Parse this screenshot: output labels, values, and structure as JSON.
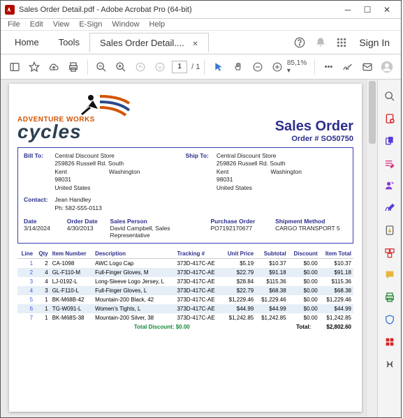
{
  "window": {
    "title": "Sales Order Detail.pdf - Adobe Acrobat Pro (64-bit)"
  },
  "menu": {
    "file": "File",
    "edit": "Edit",
    "view": "View",
    "esign": "E-Sign",
    "window": "Window",
    "help": "Help"
  },
  "tabs": {
    "home": "Home",
    "tools": "Tools",
    "active": "Sales Order Detail...."
  },
  "signin": "Sign In",
  "toolbar": {
    "page_cur": "1",
    "page_sep": "/",
    "page_total": "1",
    "zoom": "85,1%"
  },
  "doc": {
    "brand_top": "ADVENTURE WORKS",
    "brand_bottom": "cycles",
    "order_title": "Sales Order",
    "order_number_lbl": "Order # ",
    "order_number": "SO50750",
    "billto_lbl": "Bill To:",
    "shipto_lbl": "Ship To:",
    "bill": {
      "name": "Central Discount Store",
      "addr1": "259826 Russell Rd. South",
      "city": "Kent",
      "state": "Washington",
      "zip": "98031",
      "country": "United States"
    },
    "ship": {
      "name": "Central Discount Store",
      "addr1": "259826 Russell Rd. South",
      "city": "Kent",
      "state": "Washington",
      "zip": "98031",
      "country": "United States"
    },
    "contact_lbl": "Contact:",
    "contact_name": "Jean Handley",
    "contact_phone": "Ph: 582-555-0113",
    "headers": {
      "date": "Date",
      "orderdate": "Order Date",
      "salesperson": "Sales Person",
      "po": "Purchase Order",
      "ship": "Shipment Method"
    },
    "vals": {
      "date": "3/14/2024",
      "orderdate": "4/30/2013",
      "salesperson": "David Campbell, Sales Representative",
      "po": "PO7192170677",
      "ship": "CARGO TRANSPORT 5"
    },
    "cols": {
      "line": "Line",
      "qty": "Qty",
      "item": "Item Number",
      "desc": "Description",
      "track": "Tracking #",
      "unit": "Unit Price",
      "sub": "Subtotal",
      "disc": "Discount",
      "total": "Item Total"
    },
    "rows": [
      {
        "line": "1",
        "qty": "2",
        "item": "CA-1098",
        "desc": "AWC Logo Cap",
        "track": "373D-417C-AE",
        "unit": "$5.19",
        "sub": "$10.37",
        "disc": "$0.00",
        "total": "$10.37"
      },
      {
        "line": "2",
        "qty": "4",
        "item": "GL-F110-M",
        "desc": "Full-Finger Gloves, M",
        "track": "373D-417C-AE",
        "unit": "$22.79",
        "sub": "$91.18",
        "disc": "$0.00",
        "total": "$91.18"
      },
      {
        "line": "3",
        "qty": "4",
        "item": "LJ-0192-L",
        "desc": "Long-Sleeve Logo Jersey, L",
        "track": "373D-417C-AE",
        "unit": "$28.84",
        "sub": "$115.36",
        "disc": "$0.00",
        "total": "$115.36"
      },
      {
        "line": "4",
        "qty": "3",
        "item": "GL-F110-L",
        "desc": "Full-Finger Gloves, L",
        "track": "373D-417C-AE",
        "unit": "$22.79",
        "sub": "$68.38",
        "disc": "$0.00",
        "total": "$68.38"
      },
      {
        "line": "5",
        "qty": "1",
        "item": "BK-M68B-42",
        "desc": "Mountain-200 Black, 42",
        "track": "373D-417C-AE",
        "unit": "$1,229.46",
        "sub": "$1,229.46",
        "disc": "$0.00",
        "total": "$1,229.46"
      },
      {
        "line": "6",
        "qty": "1",
        "item": "TG-W091-L",
        "desc": "Women's Tights, L",
        "track": "373D-417C-AE",
        "unit": "$44.99",
        "sub": "$44.99",
        "disc": "$0.00",
        "total": "$44.99"
      },
      {
        "line": "7",
        "qty": "1",
        "item": "BK-M68S-38",
        "desc": "Mountain-200 Silver, 38",
        "track": "373D-417C-AE",
        "unit": "$1,242.85",
        "sub": "$1,242.85",
        "disc": "$0.00",
        "total": "$1,242.85"
      }
    ],
    "total_disc_lbl": "Total Discount:",
    "total_disc_val": "$0.00",
    "total_lbl": "Total:",
    "total_val": "$2,802.60"
  }
}
